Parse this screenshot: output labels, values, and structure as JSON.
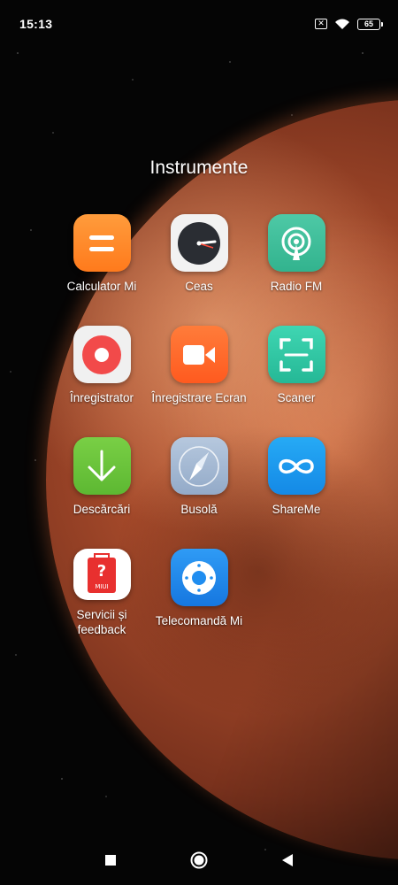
{
  "status_bar": {
    "time": "15:13",
    "sim_icon": "sim-off-icon",
    "wifi_icon": "wifi-icon",
    "battery_level": "65"
  },
  "folder": {
    "title": "Instrumente",
    "apps": [
      {
        "label": "Calculator Mi",
        "icon": "calculator-icon",
        "color": "#ff8a2b"
      },
      {
        "label": "Ceas",
        "icon": "clock-icon",
        "color": "#f2f2f2"
      },
      {
        "label": "Radio FM",
        "icon": "radio-icon",
        "color": "#3fbf9a"
      },
      {
        "label": "Înregistrator",
        "icon": "recorder-icon",
        "color": "#f0f0f0"
      },
      {
        "label": "Înregistrare Ecran",
        "icon": "screen-recorder-icon",
        "color": "#ff6a2a"
      },
      {
        "label": "Scaner",
        "icon": "scanner-icon",
        "color": "#2fc7a6"
      },
      {
        "label": "Descărcări",
        "icon": "download-icon",
        "color": "#6cc43a"
      },
      {
        "label": "Busolă",
        "icon": "compass-icon",
        "color": "#a7bcd6"
      },
      {
        "label": "ShareMe",
        "icon": "shareme-icon",
        "color": "#1a9cf0"
      },
      {
        "label": "Servicii și feedback",
        "icon": "feedback-icon",
        "color": "#ffffff"
      },
      {
        "label": "Telecomandă Mi",
        "icon": "remote-icon",
        "color": "#1f8df0"
      }
    ]
  },
  "nav_bar": {
    "recents_icon": "square-icon",
    "home_icon": "circle-icon",
    "back_icon": "triangle-back-icon"
  },
  "misc": {
    "miui_badge": "MIUI",
    "question_mark": "?"
  }
}
